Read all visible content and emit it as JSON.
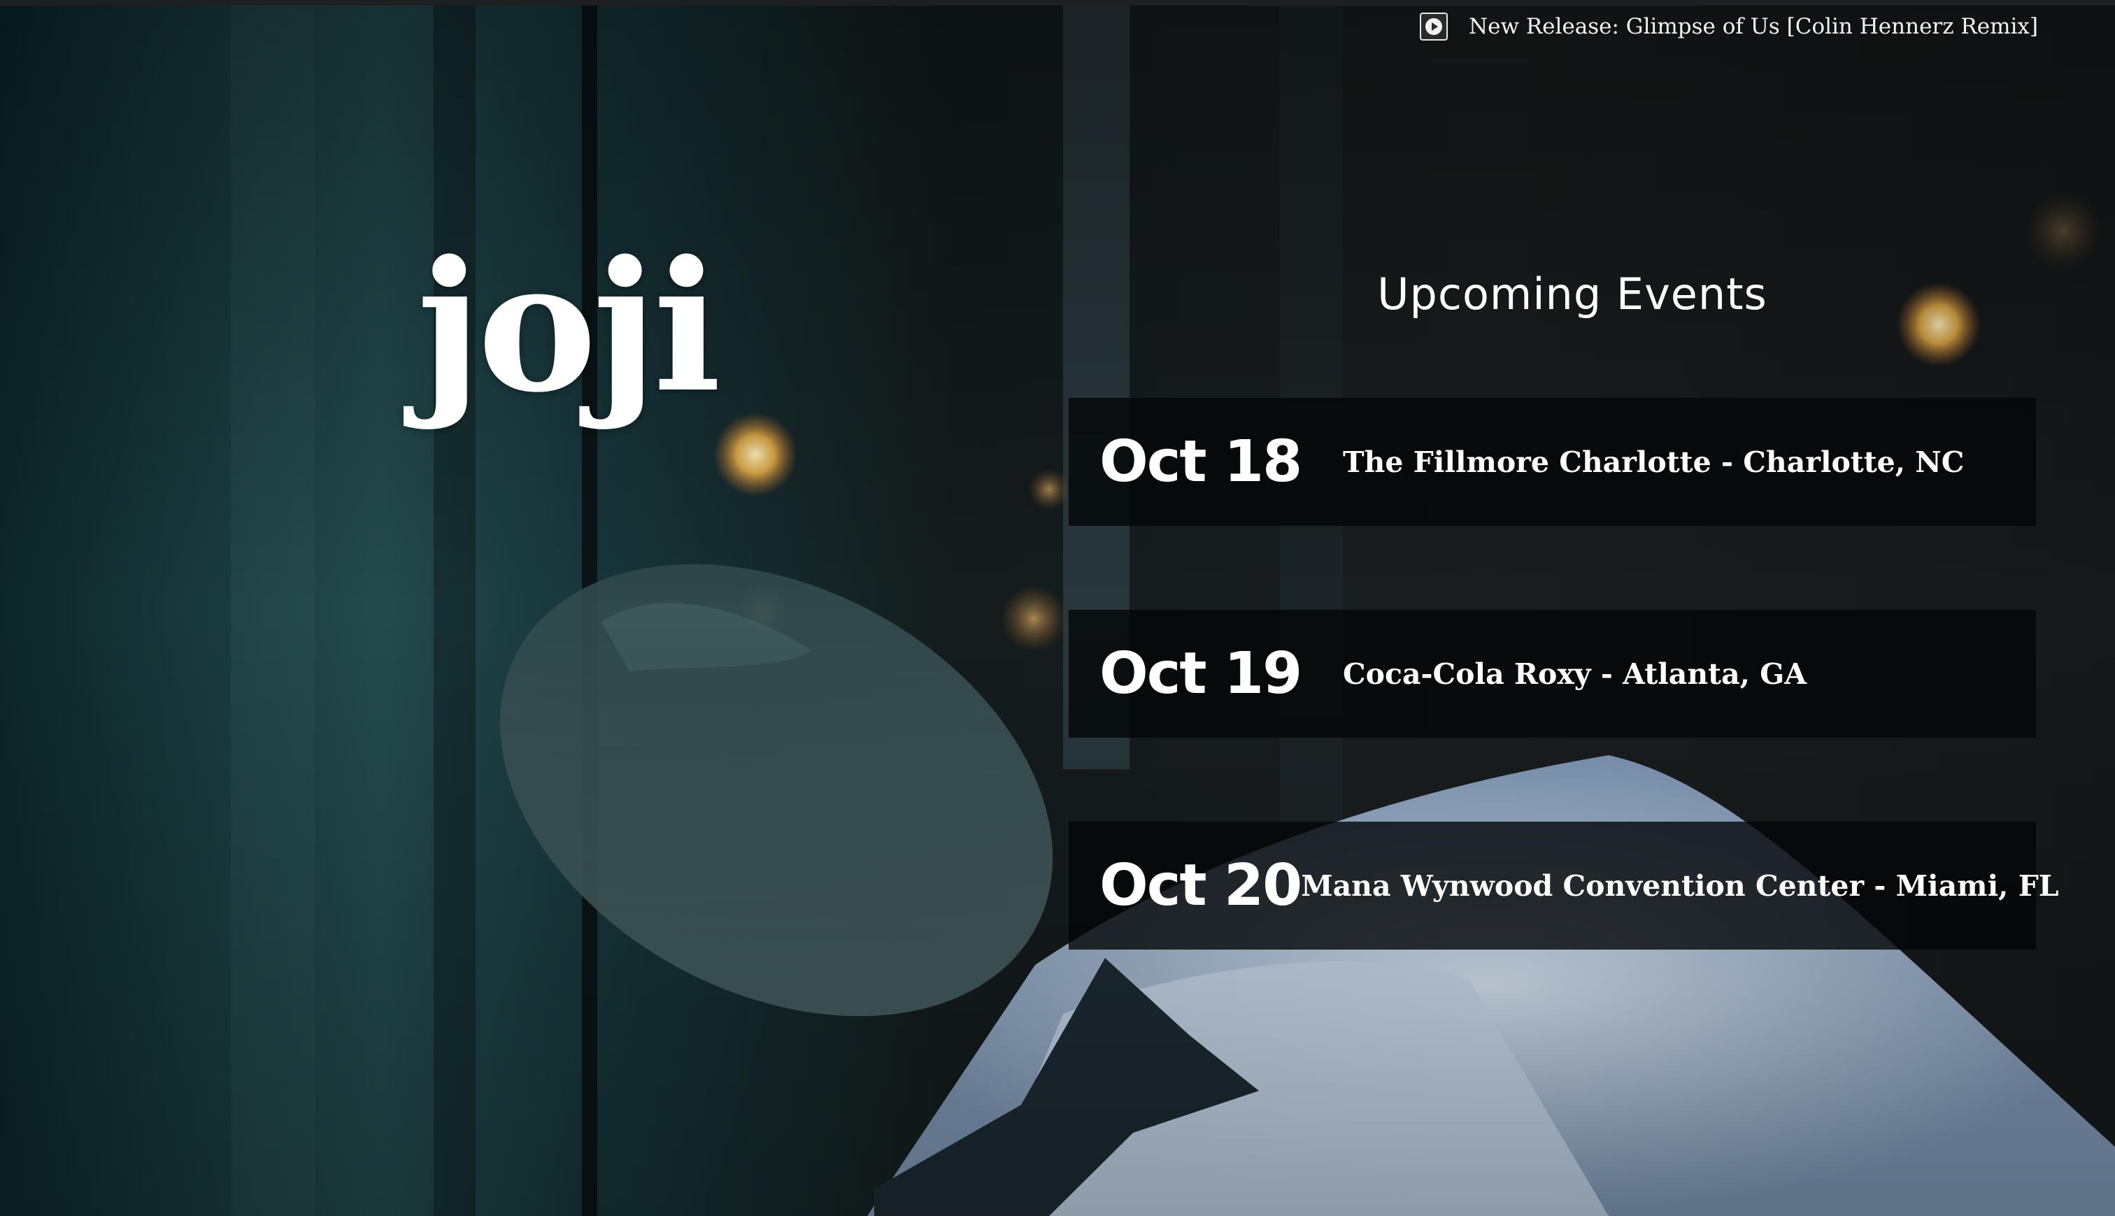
{
  "release_bar": {
    "icon": "play-icon",
    "text": "New Release: Glimpse of Us [Colin Hennerz Remix]"
  },
  "hero": {
    "logo_text": "joji"
  },
  "events": {
    "title": "Upcoming Events",
    "items": [
      {
        "date": "Oct 18",
        "venue": "The Fillmore Charlotte - Charlotte, NC"
      },
      {
        "date": "Oct 19",
        "venue": "Coca-Cola Roxy - Atlanta, GA"
      },
      {
        "date": "Oct 20",
        "venue": "Mana Wynwood Convention Center - Miami, FL"
      }
    ]
  }
}
